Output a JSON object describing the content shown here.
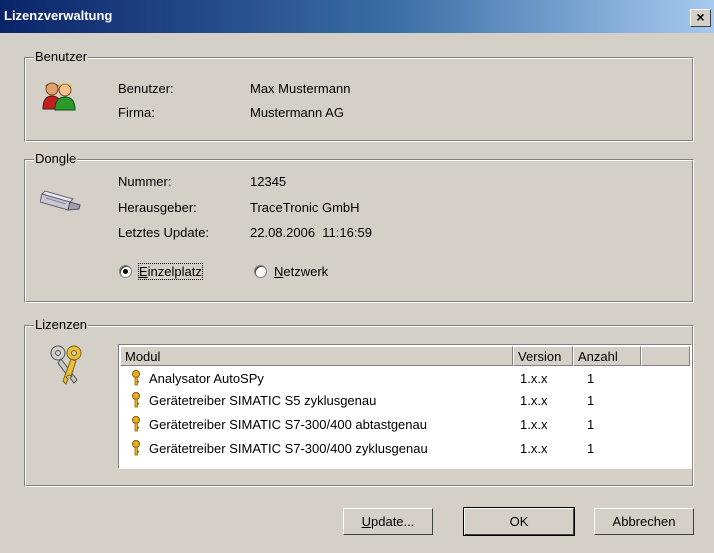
{
  "window": {
    "title": "Lizenzverwaltung",
    "close_glyph": "×"
  },
  "benutzer": {
    "legend": "Benutzer",
    "user_label": "Benutzer:",
    "user_value": "Max Mustermann",
    "company_label": "Firma:",
    "company_value": "Mustermann AG",
    "icon": "users-icon"
  },
  "dongle": {
    "legend": "Dongle",
    "number_label": "Nummer:",
    "number_value": "12345",
    "publisher_label": "Herausgeber:",
    "publisher_value": "TraceTronic GmbH",
    "update_label": "Letztes Update:",
    "update_value": "22.08.2006  11:16:59",
    "icon": "usb-dongle-icon",
    "radio_single": {
      "accel": "E",
      "rest": "inzelplatz",
      "checked": true
    },
    "radio_network": {
      "accel": "N",
      "rest": "etzwerk",
      "checked": false
    }
  },
  "lizenzen": {
    "legend": "Lizenzen",
    "icon": "keys-icon",
    "columns": [
      "Modul",
      "Version",
      "Anzahl"
    ],
    "rows": [
      {
        "modul": "Analysator AutoSPy",
        "version": "1.x.x",
        "anzahl": "1"
      },
      {
        "modul": "Gerätetreiber SIMATIC S5 zyklusgenau",
        "version": "1.x.x",
        "anzahl": "1"
      },
      {
        "modul": "Gerätetreiber SIMATIC S7-300/400 abtastgenau",
        "version": "1.x.x",
        "anzahl": "1"
      },
      {
        "modul": "Gerätetreiber SIMATIC S7-300/400 zyklusgenau",
        "version": "1.x.x",
        "anzahl": "1"
      }
    ]
  },
  "buttons": {
    "update": {
      "accel": "U",
      "rest": "pdate..."
    },
    "ok": "OK",
    "cancel": "Abbrechen"
  }
}
